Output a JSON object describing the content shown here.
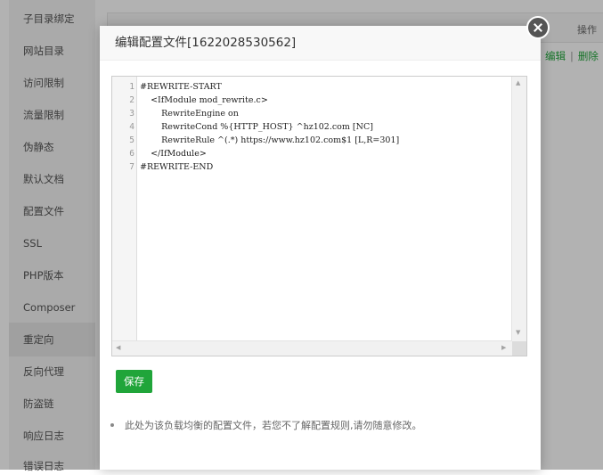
{
  "sidebar": {
    "items": [
      {
        "label": "子目录绑定"
      },
      {
        "label": "网站目录"
      },
      {
        "label": "访问限制"
      },
      {
        "label": "流量限制"
      },
      {
        "label": "伪静态"
      },
      {
        "label": "默认文档"
      },
      {
        "label": "配置文件"
      },
      {
        "label": "SSL"
      },
      {
        "label": "PHP版本"
      },
      {
        "label": "Composer"
      },
      {
        "label": "重定向"
      },
      {
        "label": "反向代理"
      },
      {
        "label": "防盗链"
      },
      {
        "label": "响应日志"
      },
      {
        "label": "错误日志"
      }
    ]
  },
  "background_table": {
    "header_operation": "操作",
    "edit_link": "编辑",
    "separator": "|",
    "delete_link": "删除"
  },
  "dialog": {
    "title": "编辑配置文件[1622028530562]",
    "editor": {
      "line_numbers": [
        "1",
        "2",
        "3",
        "4",
        "5",
        "6",
        "7"
      ],
      "lines": [
        "#REWRITE-START",
        "    <IfModule mod_rewrite.c>",
        "        RewriteEngine on",
        "        RewriteCond %{HTTP_HOST} ^hz102.com [NC]",
        "        RewriteRule ^(.*) https://www.hz102.com$1 [L,R=301]",
        "    </IfModule>",
        "#REWRITE-END"
      ]
    },
    "save_label": "保存",
    "note": "此处为该负载均衡的配置文件，若您不了解配置规则,请勿随意修改。"
  },
  "colors": {
    "accent": "#20a53a",
    "overlay": "rgba(0,0,0,0.30)"
  },
  "icons": {
    "close": "close-icon",
    "scroll_up": "scroll-up-arrow-icon",
    "scroll_down": "scroll-down-arrow-icon",
    "scroll_left": "scroll-left-arrow-icon",
    "scroll_right": "scroll-right-arrow-icon"
  }
}
